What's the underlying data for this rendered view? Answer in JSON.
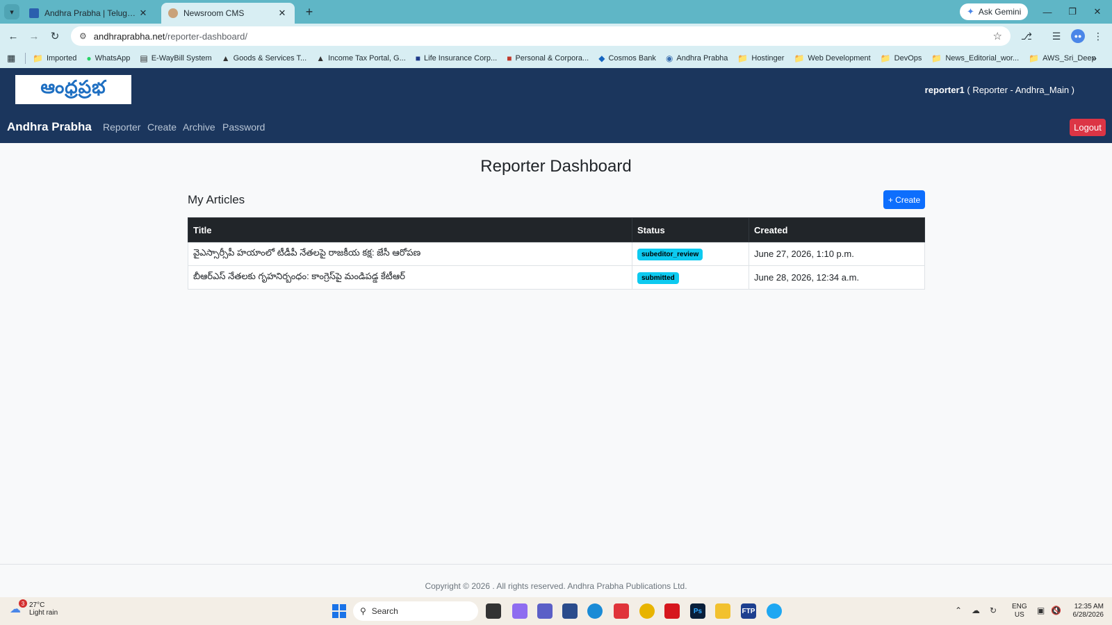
{
  "browser": {
    "tabs": [
      {
        "title": "Andhra Prabha | Telugu News D",
        "active": false
      },
      {
        "title": "Newsroom CMS",
        "active": true
      }
    ],
    "new_tab": "+",
    "ask_gemini": "Ask Gemini",
    "url_host": "andhraprabha.net",
    "url_path": "/reporter-dashboard/",
    "bookmarks": [
      {
        "label": "Imported",
        "icon": "folder-icon"
      },
      {
        "label": "WhatsApp",
        "icon": "whatsapp-icon"
      },
      {
        "label": "E-WayBill System",
        "icon": "ewaybill-icon"
      },
      {
        "label": "Goods & Services T...",
        "icon": "gst-icon"
      },
      {
        "label": "Income Tax Portal, G...",
        "icon": "income-tax-icon"
      },
      {
        "label": "Life Insurance Corp...",
        "icon": "lic-icon"
      },
      {
        "label": "Personal & Corpora...",
        "icon": "bank-icon"
      },
      {
        "label": "Cosmos Bank",
        "icon": "cosmos-bank-icon"
      },
      {
        "label": "Andhra Prabha",
        "icon": "globe-icon"
      },
      {
        "label": "Hostinger",
        "icon": "folder-icon"
      },
      {
        "label": "Web Development",
        "icon": "folder-icon"
      },
      {
        "label": "DevOps",
        "icon": "folder-icon"
      },
      {
        "label": "News_Editorial_wor...",
        "icon": "folder-icon"
      },
      {
        "label": "AWS_Sri_Deep",
        "icon": "folder-icon"
      }
    ]
  },
  "header": {
    "logo_text": "ఆంధ్రప్రభ",
    "username": "reporter1",
    "role": "( Reporter - Andhra_Main )"
  },
  "nav": {
    "brand": "Andhra Prabha",
    "links": [
      "Reporter",
      "Create",
      "Archive",
      "Password"
    ],
    "logout": "Logout"
  },
  "main": {
    "page_title": "Reporter Dashboard",
    "section_title": "My Articles",
    "create_button": "+ Create",
    "table": {
      "headers": [
        "Title",
        "Status",
        "Created"
      ],
      "rows": [
        {
          "title": "వైఎస్సార్సీపీ హయాంలో టీడీపీ నేతలపై రాజకీయ కక్ష: జేసీ ఆరోపణ",
          "status": "subeditor_review",
          "created": "June 27, 2026, 1:10 p.m."
        },
        {
          "title": "బీఆర్ఎస్ నేతలకు గృహనిర్బంధం: కాంగ్రెస్‌పై మండిపడ్డ కేటీఆర్",
          "status": "submitted",
          "created": "June 28, 2026, 12:34 a.m."
        }
      ]
    }
  },
  "footer": {
    "copyright": "Copyright © 2026 . All rights reserved. Andhra Prabha Publications Ltd."
  },
  "taskbar": {
    "weather_temp": "27°C",
    "weather_desc": "Light rain",
    "weather_badge": "3",
    "search_placeholder": "Search",
    "lang_top": "ENG",
    "lang_bottom": "US",
    "time": "12:35 AM",
    "date": "6/28/2026"
  },
  "colors": {
    "brand_navy": "#1b365d",
    "logout_red": "#dc3545",
    "create_blue": "#0d6efd",
    "badge_cyan": "#0dcaf0"
  }
}
